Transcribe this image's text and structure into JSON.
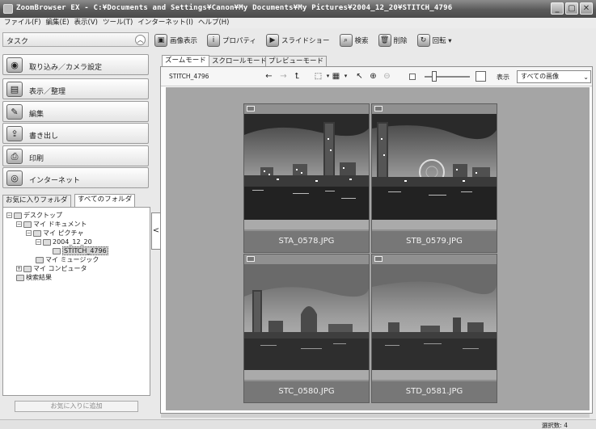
{
  "window": {
    "title": "ZoomBrowser EX - C:¥Documents and Settings¥Canon¥My Documents¥My Pictures¥2004_12_20¥STITCH_4796",
    "buttons": {
      "minimize": "_",
      "maximize": "▢",
      "close": "✕"
    }
  },
  "menu": [
    "ファイル(F)",
    "編集(E)",
    "表示(V)",
    "ツール(T)",
    "インターネット(I)",
    "ヘルプ(H)"
  ],
  "task_panel": {
    "header": "タスク",
    "buttons": [
      {
        "label": "取り込み／カメラ設定",
        "icon": "camera-icon"
      },
      {
        "label": "表示／整理",
        "icon": "folder-view-icon"
      },
      {
        "label": "編集",
        "icon": "edit-pencil-icon"
      },
      {
        "label": "書き出し",
        "icon": "export-icon"
      },
      {
        "label": "印刷",
        "icon": "printer-icon"
      },
      {
        "label": "インターネット",
        "icon": "internet-globe-icon"
      }
    ]
  },
  "folder_tabs": [
    "お気に入りフォルダ",
    "すべてのフォルダ"
  ],
  "folder_tabs_active": "すべてのフォルダ",
  "tree": [
    {
      "label": "デスクトップ",
      "depth": 0,
      "toggle": "−"
    },
    {
      "label": "マイ ドキュメント",
      "depth": 1,
      "toggle": "−"
    },
    {
      "label": "マイ ピクチャ",
      "depth": 2,
      "toggle": "−"
    },
    {
      "label": "2004_12_20",
      "depth": 3,
      "toggle": "−"
    },
    {
      "label": "STITCH_4796",
      "depth": 4,
      "toggle": "",
      "selected": true
    },
    {
      "label": "マイ ミュージック",
      "depth": 2,
      "toggle": ""
    },
    {
      "label": "マイ コンピュータ",
      "depth": 1,
      "toggle": "+"
    },
    {
      "label": "検索結果",
      "depth": 1,
      "toggle": ""
    }
  ],
  "add_favorite": "お気に入りに追加",
  "collapse_arrow": "<",
  "toolbar": [
    {
      "label": "画像表示",
      "icon": "image-view-icon"
    },
    {
      "label": "プロパティ",
      "icon": "properties-info-icon"
    },
    {
      "label": "スライドショー",
      "icon": "slideshow-icon"
    },
    {
      "label": "検索",
      "icon": "search-magnifier-icon"
    },
    {
      "label": "削除",
      "icon": "trash-icon"
    },
    {
      "label": "回転 ▾",
      "icon": "rotate-icon"
    }
  ],
  "mode_tabs": [
    "ズームモード",
    "スクロールモード",
    "プレビューモード"
  ],
  "mode_tabs_active": "ズームモード",
  "viewer": {
    "breadcrumb": "STITCH_4796",
    "display_label": "表示",
    "display_select": "すべての画像"
  },
  "thumbnails": [
    {
      "name": "STA_0578.JPG",
      "scene": "night"
    },
    {
      "name": "STB_0579.JPG",
      "scene": "night"
    },
    {
      "name": "STC_0580.JPG",
      "scene": "dusk"
    },
    {
      "name": "STD_0581.JPG",
      "scene": "dusk"
    }
  ],
  "status": "選択数: 4"
}
